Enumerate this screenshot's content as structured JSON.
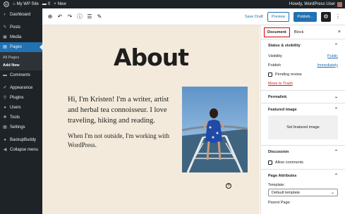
{
  "admin_bar": {
    "site_name": "My WP Site",
    "comments_count": "0",
    "new_label": "New",
    "howdy": "Howdy, WordPress User"
  },
  "sidebar": {
    "items": [
      {
        "label": "Dashboard",
        "icon": "dashboard-icon",
        "glyph": "◐"
      },
      {
        "label": "Posts",
        "icon": "pin-icon",
        "glyph": "✎"
      },
      {
        "label": "Media",
        "icon": "media-icon",
        "glyph": "▣"
      },
      {
        "label": "Pages",
        "icon": "pages-icon",
        "glyph": "▤"
      },
      {
        "label": "Comments",
        "icon": "comment-icon",
        "glyph": "▬"
      },
      {
        "label": "Appearance",
        "icon": "brush-icon",
        "glyph": "✐"
      },
      {
        "label": "Plugins",
        "icon": "plugin-icon",
        "glyph": "⚲"
      },
      {
        "label": "Users",
        "icon": "user-icon",
        "glyph": "●"
      },
      {
        "label": "Tools",
        "icon": "wrench-icon",
        "glyph": "✚"
      },
      {
        "label": "Settings",
        "icon": "settings-icon",
        "glyph": "▦"
      },
      {
        "label": "BackupBuddy",
        "icon": "backup-icon",
        "glyph": "●"
      },
      {
        "label": "Collapse menu",
        "icon": "collapse-icon",
        "glyph": "◀"
      }
    ],
    "submenu": {
      "all_pages": "All Pages",
      "add_new": "Add New"
    }
  },
  "toolbar": {
    "save_draft": "Save Draft",
    "preview": "Preview",
    "publish": "Publish...",
    "add_glyph": "⊕",
    "undo_glyph": "↶",
    "redo_glyph": "↷",
    "info_glyph": "ⓘ",
    "list_glyph": "☰",
    "tools_glyph": "✎",
    "gear_glyph": "⚙",
    "more_glyph": "⋮"
  },
  "content": {
    "title": "About",
    "paragraph1": "Hi, I'm Kristen! I'm a writer, artist and herbal tea connoisseur. I love traveling, hiking and reading.",
    "paragraph2": "When I'm not outside, I'm working with WordPress."
  },
  "settings_panel": {
    "tab_document": "Document",
    "tab_block": "Block",
    "close_glyph": "×",
    "status": {
      "heading": "Status & visibility",
      "visibility_label": "Visibility",
      "visibility_value": "Public",
      "publish_label": "Publish",
      "publish_value": "Immediately",
      "pending_review": "Pending review",
      "move_to_trash": "Move to Trash"
    },
    "permalink": "Permalink",
    "featured_image": {
      "heading": "Featured image",
      "button": "Set featured image"
    },
    "discussion": {
      "heading": "Discussion",
      "allow_comments": "Allow comments"
    },
    "page_attributes": {
      "heading": "Page Attributes",
      "template_label": "Template:",
      "template_value": "Default template",
      "parent_label": "Parent Page:"
    },
    "chevron_up": "⌃",
    "chevron_down": "⌄"
  },
  "colors": {
    "accent": "#2271b1",
    "admin_dark": "#1d2327",
    "canvas_bg": "#f3eadb",
    "trash_red": "#cc1818"
  }
}
